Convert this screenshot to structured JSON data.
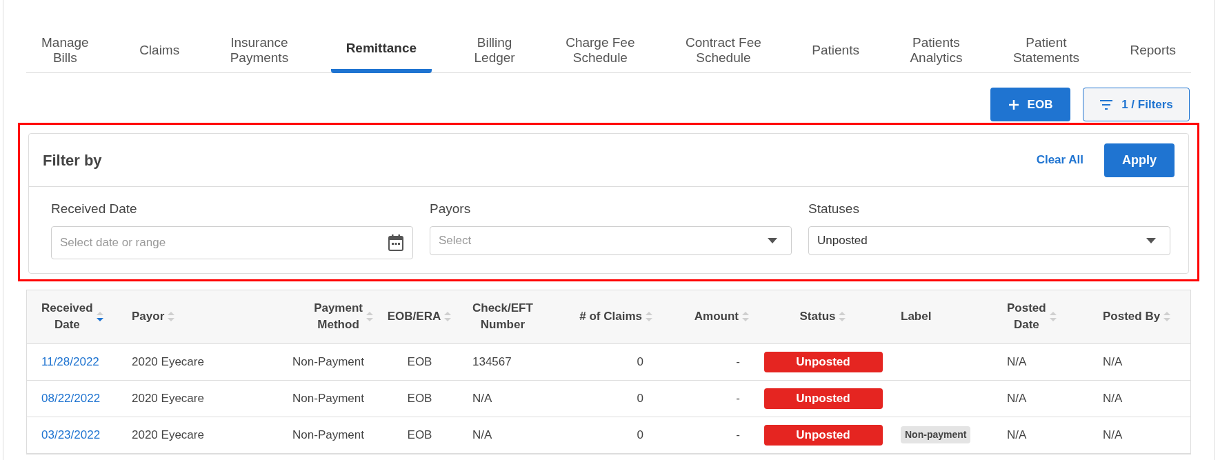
{
  "tabs": [
    {
      "label": "Manage\nBills",
      "selected": false
    },
    {
      "label": "Claims",
      "selected": false
    },
    {
      "label": "Insurance\nPayments",
      "selected": false
    },
    {
      "label": "Remittance",
      "selected": true
    },
    {
      "label": "Billing\nLedger",
      "selected": false
    },
    {
      "label": "Charge Fee\nSchedule",
      "selected": false
    },
    {
      "label": "Contract Fee\nSchedule",
      "selected": false
    },
    {
      "label": "Patients",
      "selected": false
    },
    {
      "label": "Patients\nAnalytics",
      "selected": false
    },
    {
      "label": "Patient\nStatements",
      "selected": false
    },
    {
      "label": "Reports",
      "selected": false
    }
  ],
  "actions": {
    "add_button": "EOB",
    "filters_button": "1 / Filters"
  },
  "filter_panel": {
    "title": "Filter by",
    "clear_link": "Clear All",
    "apply_button": "Apply",
    "fields": [
      {
        "kind": "date",
        "label": "Received Date",
        "placeholder": "Select date or range"
      },
      {
        "kind": "select",
        "label": "Payors",
        "placeholder": "Select"
      },
      {
        "kind": "select",
        "label": "Statuses",
        "value": "Unposted"
      }
    ]
  },
  "table": {
    "columns": [
      {
        "label": "Received\nDate",
        "sortable": true,
        "sorted_descending": true
      },
      {
        "label": "Payor",
        "sortable": true,
        "sorted_descending": false
      },
      {
        "label": "Payment\nMethod",
        "sortable": true,
        "sorted_descending": false
      },
      {
        "label": "EOB/ERA",
        "sortable": true,
        "sorted_descending": false
      },
      {
        "label": "Check/EFT\nNumber",
        "sortable": false
      },
      {
        "label": "# of Claims",
        "sortable": true,
        "sorted_descending": false
      },
      {
        "label": "Amount",
        "sortable": true,
        "sorted_descending": false
      },
      {
        "label": "Status",
        "sortable": true,
        "sorted_descending": false
      },
      {
        "label": "Label",
        "sortable": false
      },
      {
        "label": "Posted\nDate",
        "sortable": true,
        "sorted_descending": false
      },
      {
        "label": "Posted By",
        "sortable": true,
        "sorted_descending": false
      }
    ],
    "rows": [
      {
        "received_date": "11/28/2022",
        "payor": "2020 Eyecare",
        "payment_method": "Non-Payment",
        "eob_era": "EOB",
        "check_number": "134567",
        "claims": "0",
        "amount": "-",
        "status": "Unposted",
        "posted_date": "N/A",
        "posted_by": "N/A"
      },
      {
        "received_date": "08/22/2022",
        "payor": "2020 Eyecare",
        "payment_method": "Non-Payment",
        "eob_era": "EOB",
        "check_number": "N/A",
        "claims": "0",
        "amount": "-",
        "status": "Unposted",
        "posted_date": "N/A",
        "posted_by": "N/A"
      },
      {
        "received_date": "03/23/2022",
        "payor": "2020 Eyecare",
        "payment_method": "Non-Payment",
        "eob_era": "EOB",
        "check_number": "N/A",
        "claims": "0",
        "amount": "-",
        "status": "Unposted",
        "label": "Non-payment",
        "posted_date": "N/A",
        "posted_by": "N/A"
      }
    ]
  }
}
